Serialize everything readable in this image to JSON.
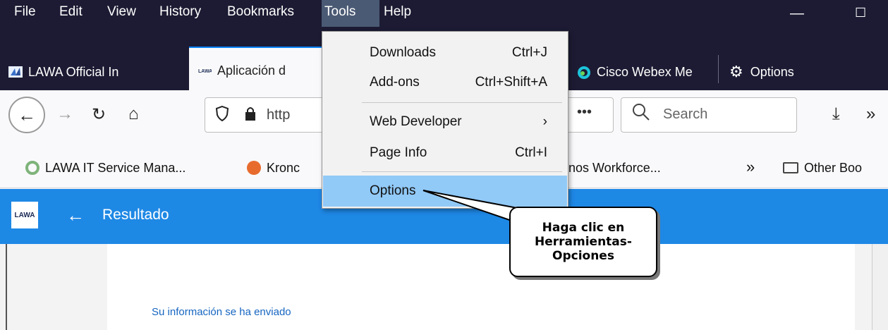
{
  "menubar": {
    "file": "File",
    "edit": "Edit",
    "view": "View",
    "history": "History",
    "bookmarks": "Bookmarks",
    "tools": "Tools",
    "help": "Help"
  },
  "tabs": [
    {
      "label": "LAWA Official In",
      "icon": "lawa-favicon"
    },
    {
      "label": "Aplicación d",
      "icon": "lawa-small-favicon",
      "selected": true
    },
    {
      "label": "Cisco Webex Me",
      "icon": "webex-favicon"
    },
    {
      "label": "Options",
      "icon": "gear-icon"
    }
  ],
  "navbar": {
    "url_partial": "http",
    "more": "•••",
    "search_placeholder": "Search"
  },
  "bookmarks": {
    "item1": "LAWA IT Service Mana...",
    "item2": "Kronc",
    "item3": "nos Workforce...",
    "overflow": "»",
    "other": "Other Boo"
  },
  "page": {
    "logo": "LAWA",
    "title": "Resultado",
    "status": "Su información se ha enviado"
  },
  "tools_menu": {
    "downloads": {
      "label": "Downloads",
      "shortcut": "Ctrl+J"
    },
    "addons": {
      "label": "Add-ons",
      "shortcut": "Ctrl+Shift+A"
    },
    "web_developer": {
      "label": "Web Developer",
      "arrow": "›"
    },
    "page_info": {
      "label": "Page Info",
      "shortcut": "Ctrl+I"
    },
    "options": {
      "label": "Options"
    }
  },
  "callout": {
    "line1": "Haga clic en",
    "line2": "Herramientas-",
    "line3": "Opciones"
  },
  "colors": {
    "chrome": "#1c1b33",
    "header_blue": "#1e88e5",
    "menu_highlight": "#91c9f7"
  }
}
